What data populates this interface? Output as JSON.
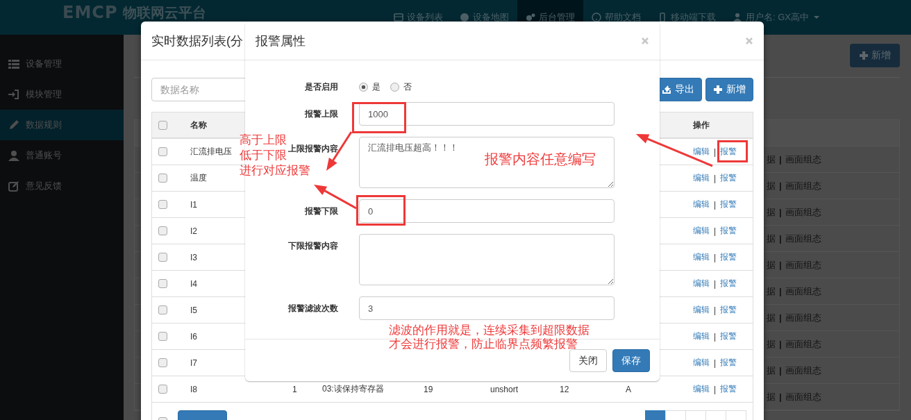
{
  "navbar": {
    "logo": "EMCP",
    "brand": "物联网云平台",
    "items": [
      {
        "label": "设备列表",
        "selected": false
      },
      {
        "label": "设备地图",
        "selected": false
      },
      {
        "label": "后台管理",
        "selected": true
      },
      {
        "label": "帮助文档",
        "selected": false
      },
      {
        "label": "移动端下载",
        "selected": false
      },
      {
        "label": "用户名: GX高中",
        "selected": false
      }
    ]
  },
  "sidebar": {
    "items": [
      {
        "label": "设备管理",
        "selected": false
      },
      {
        "label": "模块管理",
        "selected": false
      },
      {
        "label": "数据规则",
        "selected": true
      },
      {
        "label": "普通账号",
        "selected": false
      },
      {
        "label": "意见反馈",
        "selected": false
      }
    ]
  },
  "page": {
    "add_button": "新增",
    "rows": [
      [
        "据",
        "|",
        "画面组态"
      ],
      [
        "据",
        "|",
        "画面组态"
      ],
      [
        "据",
        "|",
        "画面组态"
      ],
      [
        "据",
        "|",
        "画面组态"
      ],
      [
        "据",
        "|",
        "画面组态"
      ],
      [
        "据",
        "|",
        "画面组态"
      ],
      [
        "据",
        "|",
        "画面组态"
      ],
      [
        "据",
        "|",
        "画面组态"
      ],
      [
        "据",
        "|",
        "画面组态"
      ],
      [
        "据",
        "|",
        "画面组态"
      ]
    ]
  },
  "data_list_modal": {
    "title": "实时数据列表(分",
    "search": {
      "placeholder": "数据名称"
    },
    "export_button": "导出",
    "add_button": "新增",
    "table": {
      "header": {
        "checked": false,
        "name": "名称",
        "actions": "操作"
      },
      "rows": [
        {
          "checked": false,
          "name": "汇流排电压",
          "actions": [
            "编辑",
            "|",
            "报警"
          ]
        },
        {
          "checked": false,
          "name": "温度",
          "actions": [
            "编辑",
            "|",
            "报警"
          ]
        },
        {
          "checked": false,
          "name": "I1",
          "actions": [
            "编辑",
            "|",
            "报警"
          ]
        },
        {
          "checked": false,
          "name": "I2",
          "actions": [
            "编辑",
            "|",
            "报警"
          ]
        },
        {
          "checked": false,
          "name": "I3",
          "actions": [
            "编辑",
            "|",
            "报警"
          ]
        },
        {
          "checked": false,
          "name": "I4",
          "actions": [
            "编辑",
            "|",
            "报警"
          ]
        },
        {
          "checked": false,
          "name": "I5",
          "actions": [
            "编辑",
            "|",
            "报警"
          ]
        },
        {
          "checked": false,
          "name": "I6",
          "actions": [
            "编辑",
            "|",
            "报警"
          ]
        },
        {
          "checked": false,
          "name": "I7",
          "actions": [
            "编辑",
            "|",
            "报警"
          ]
        },
        {
          "checked": false,
          "name": "I8",
          "cells": [
            "1",
            "03:读保持寄存器",
            "19",
            "unshort",
            "12",
            "A"
          ],
          "actions": [
            "编辑",
            "|",
            "报警"
          ]
        }
      ]
    },
    "footer": {
      "checked": false,
      "pagination": [
        {
          "selected": true
        },
        {
          "selected": false
        },
        {
          "selected": false
        },
        {
          "selected": false
        },
        {
          "selected": false
        }
      ]
    }
  },
  "alarm_modal": {
    "title": "报警属性",
    "fields": [
      {
        "kind": "radio",
        "label": "是否启用",
        "options": [
          {
            "label": "是",
            "selected": true
          },
          {
            "label": "否",
            "selected": false
          }
        ]
      },
      {
        "kind": "input",
        "label": "报警上限",
        "value": "1000"
      },
      {
        "kind": "textarea",
        "label": "上限报警内容",
        "value": "汇流排电压超高！！！"
      },
      {
        "kind": "input",
        "label": "报警下限",
        "value": "0"
      },
      {
        "kind": "textarea",
        "label": "下限报警内容"
      },
      {
        "kind": "input",
        "label": "报警滤波次数",
        "value": "3"
      }
    ],
    "buttons": [
      "关闭",
      "保存"
    ]
  },
  "annotations": [
    {
      "lines": [
        "高于上限",
        "低于下限",
        "进行对应报警"
      ]
    },
    {
      "lines": [
        "报警内容任意编写"
      ]
    },
    {
      "lines": [
        "滤波的作用就是，连续采集到超限数据",
        "才会进行报警，防止临界点频繁报警"
      ]
    }
  ]
}
